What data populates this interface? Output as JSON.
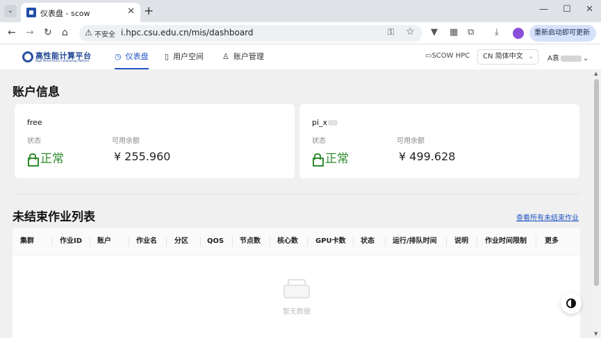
{
  "browser": {
    "tab_list_glyph": "⌄",
    "tab_title": "仪表盘 - scow",
    "tab_close": "✕",
    "new_tab": "+",
    "minimize": "—",
    "maximize": "☐",
    "close": "✕",
    "back": "←",
    "forward": "→",
    "reload": "↻",
    "home": "⌂",
    "warning_glyph": "⚠",
    "insecure_label": "不安全",
    "url": "i.hpc.csu.edu.cn/mis/dashboard",
    "update_label": "重新启动即可更新 ⋮"
  },
  "header": {
    "logo_text": "高性能计算平台",
    "logo_subtext": "High Performance Computing Platform",
    "menu": [
      {
        "label": "仪表盘",
        "icon": "dashboard-icon"
      },
      {
        "label": "用户空间",
        "icon": "book-icon"
      },
      {
        "label": "账户管理",
        "icon": "user-icon"
      }
    ],
    "scow_label": "SCOW HPC",
    "language": "CN 简体中文",
    "user_prefix": "A袁",
    "user_suffix": "⌄"
  },
  "account_section": {
    "title": "账户信息",
    "status_label": "状态",
    "balance_label": "可用余额",
    "accounts": [
      {
        "name": "free",
        "status": "正常",
        "balance": "¥ 255.960"
      },
      {
        "name": "pi_x",
        "status": "正常",
        "balance": "¥ 499.628"
      }
    ]
  },
  "jobs_section": {
    "title": "未结束作业列表",
    "view_all": "查看所有未结束作业",
    "columns": [
      "集群",
      "作业ID",
      "账户",
      "作业名",
      "分区",
      "QOS",
      "节点数",
      "核心数",
      "GPU卡数",
      "状态",
      "运行/排队时间",
      "说明",
      "作业时间限制",
      "更多"
    ],
    "empty_text": "暂无数据"
  }
}
